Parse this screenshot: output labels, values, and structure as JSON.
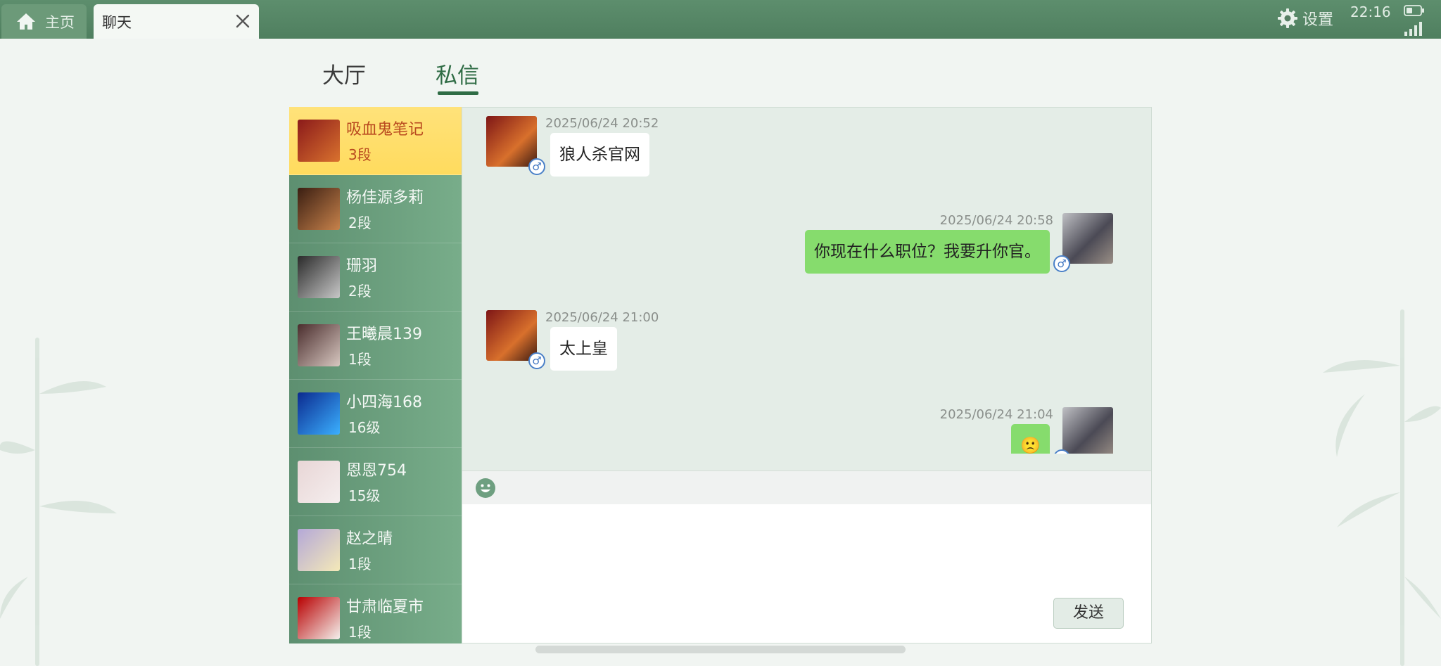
{
  "tabs": {
    "home_label": "主页",
    "chat_label": "聊天"
  },
  "status": {
    "settings_label": "设置",
    "time": "22:16"
  },
  "sections": {
    "lobby": "大厅",
    "direct": "私信"
  },
  "contacts": [
    {
      "name": "吸血鬼笔记",
      "level": "3段",
      "selected": true,
      "avatar_colors": [
        "#8b1a1a",
        "#d9722e"
      ]
    },
    {
      "name": "杨佳源多莉",
      "level": "2段",
      "avatar_colors": [
        "#3a1e12",
        "#c7824b"
      ]
    },
    {
      "name": "珊羽",
      "level": "2段",
      "avatar_colors": [
        "#2a2a2a",
        "#c8c8c8"
      ]
    },
    {
      "name": "王曦晨139",
      "level": "1段",
      "avatar_colors": [
        "#4a2d2d",
        "#d7c7c0"
      ]
    },
    {
      "name": "小四海168",
      "level": "16级",
      "avatar_colors": [
        "#0b2a8f",
        "#3bb0ff"
      ]
    },
    {
      "name": "恩恩754",
      "level": "15级",
      "avatar_colors": [
        "#e8d6d6",
        "#f5eeee"
      ]
    },
    {
      "name": "赵之晴",
      "level": "1段",
      "avatar_colors": [
        "#b4a8d8",
        "#f4e9b8"
      ]
    },
    {
      "name": "甘肃临夏市",
      "level": "1段",
      "avatar_colors": [
        "#b80000",
        "#f4f1ee"
      ]
    }
  ],
  "messages": [
    {
      "side": "left",
      "time": "2025/06/24 20:52",
      "text": "狼人杀官网"
    },
    {
      "side": "right",
      "time": "2025/06/24 20:58",
      "text": "你现在什么职位？我要升你官。"
    },
    {
      "side": "left",
      "time": "2025/06/24 21:00",
      "text": "太上皇"
    },
    {
      "side": "right",
      "time": "2025/06/24 21:04",
      "text": "🙁"
    }
  ],
  "gender_symbol": "♂",
  "composer": {
    "send_label": "发送"
  },
  "colors": {
    "accent": "#2f6c45",
    "bubble_self": "#86dc6d",
    "selected_contact": "#ffe27a"
  }
}
